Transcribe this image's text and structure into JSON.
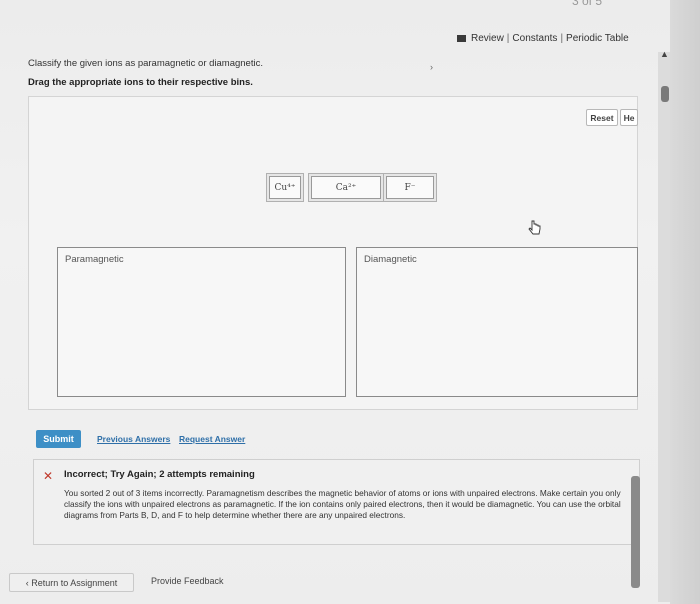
{
  "header": {
    "page_number": "3 of 5",
    "links": [
      "Review",
      "Constants",
      "Periodic Table"
    ],
    "separator": "|"
  },
  "instructions": {
    "line1": "Classify the given ions as paramagnetic or diamagnetic.",
    "line2": "Drag the appropriate ions to their respective bins."
  },
  "workspace": {
    "reset_label": "Reset",
    "help_label": "He",
    "tiles": [
      "Cu⁴⁺",
      "Ca²⁺",
      "F⁻"
    ],
    "bins": {
      "left": "Paramagnetic",
      "right": "Diamagnetic"
    }
  },
  "actions": {
    "submit_label": "Submit",
    "previous_answers": "Previous Answers",
    "request_answer": "Request Answer"
  },
  "feedback": {
    "icon": "x-icon",
    "title": "Incorrect; Try Again; 2 attempts remaining",
    "body": "You sorted 2 out of 3 items incorrectly. Paramagnetism describes the magnetic behavior of atoms or ions with unpaired electrons. Make certain you only classify the ions with unpaired electrons as paramagnetic. If the ion contains only paired electrons, then it would be diamagnetic. You can use the orbital diagrams from Parts B, D, and F to help determine whether there are any unpaired electrons."
  },
  "footer": {
    "return_label": "‹ Return to Assignment",
    "feedback_label": "Provide Feedback"
  },
  "colors": {
    "submit_bg": "#3d8fc6",
    "link": "#2e6fa8",
    "error": "#c0392b"
  }
}
